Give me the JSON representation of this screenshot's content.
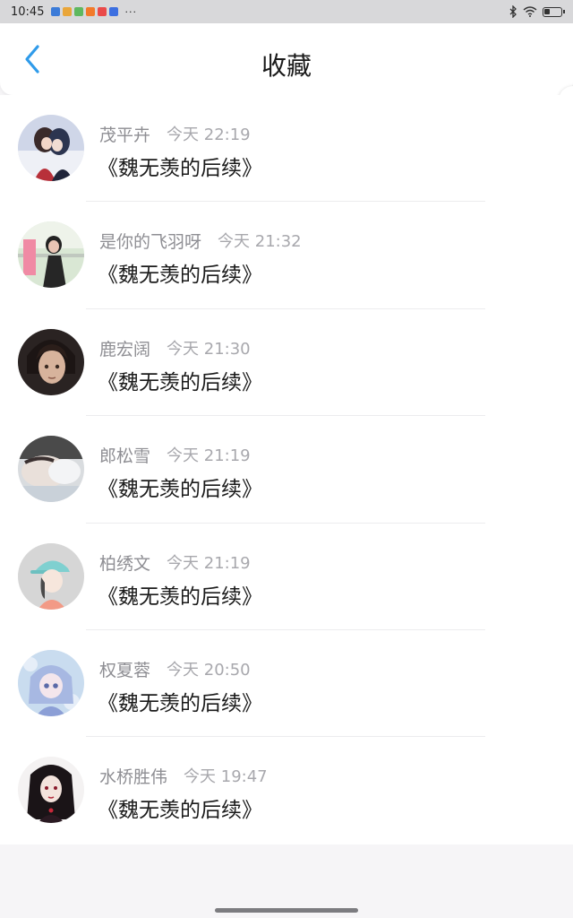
{
  "status_bar": {
    "time": "10:45",
    "more": "···",
    "app_icon_colors": [
      "#3b7bd8",
      "#e9a63a",
      "#5fb85f",
      "#f27a2a",
      "#ea4a4a",
      "#3c6fe0"
    ]
  },
  "header": {
    "title": "收藏"
  },
  "colors": {
    "accent": "#2f9bea",
    "divider": "#ececee",
    "time_text": "#a8a8ad"
  },
  "favorites": [
    {
      "name": "茂平卉",
      "time": "今天 22:19",
      "content": "《魏无羡的后续》"
    },
    {
      "name": "是你的飞羽呀",
      "time": "今天 21:32",
      "content": "《魏无羡的后续》"
    },
    {
      "name": "鹿宏阔",
      "time": "今天 21:30",
      "content": "《魏无羡的后续》"
    },
    {
      "name": "郎松雪",
      "time": "今天 21:19",
      "content": "《魏无羡的后续》"
    },
    {
      "name": "柏绣文",
      "time": "今天 21:19",
      "content": "《魏无羡的后续》"
    },
    {
      "name": "权夏蓉",
      "time": "今天 20:50",
      "content": "《魏无羡的后续》"
    },
    {
      "name": "水桥胜伟",
      "time": "今天 19:47",
      "content": "《魏无羡的后续》"
    }
  ]
}
